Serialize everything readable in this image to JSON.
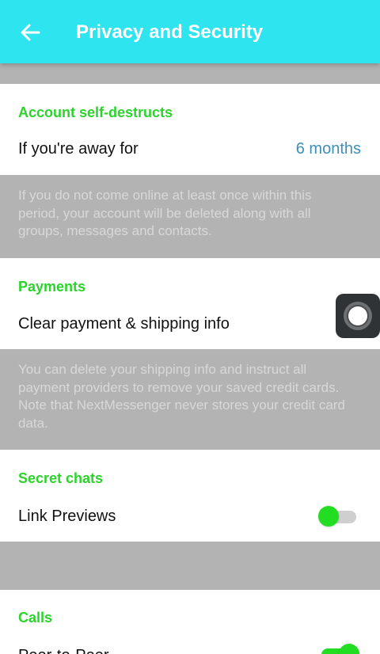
{
  "header": {
    "title": "Privacy and Security",
    "back_icon": "arrow-left-icon",
    "background": "#2ee4ee"
  },
  "account_self_destruct": {
    "title": "Account self-destructs",
    "row_label": "If you're away for",
    "row_value": "6 months",
    "info": "If you do not come online at least once within this period, your account will be deleted along with all groups, messages and contacts."
  },
  "payments": {
    "title": "Payments",
    "row_label": "Clear payment & shipping info",
    "info": "You can delete your shipping info and instruct all payment providers to remove your saved credit cards. Note that NextMessenger never stores your credit card data."
  },
  "secret_chats": {
    "title": "Secret chats",
    "link_previews_label": "Link Previews",
    "link_previews_enabled": false
  },
  "calls": {
    "title": "Calls",
    "peer_label": "Peer-to-Peer",
    "peer_enabled": true
  },
  "colors": {
    "accent_green": "#2cd32c",
    "value_blue": "#3d8fb8",
    "divider_gray": "#b3b3b3"
  },
  "overlay": {
    "assistive_icon": "assistive-touch-icon"
  }
}
